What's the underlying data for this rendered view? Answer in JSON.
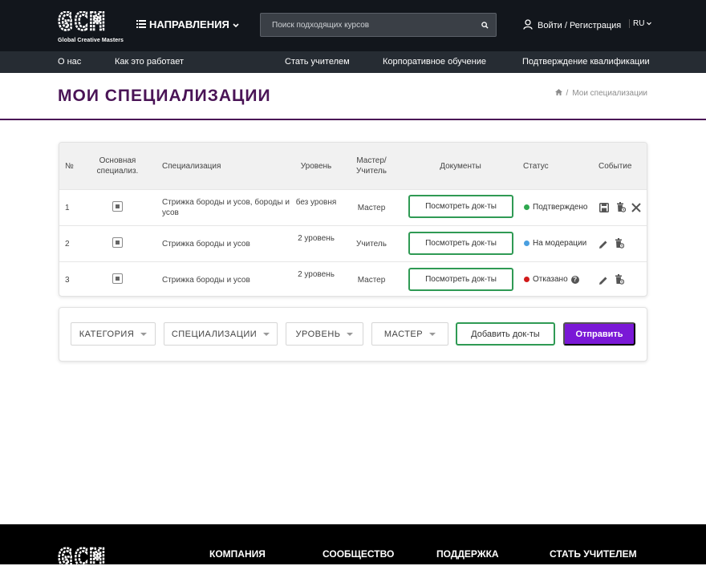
{
  "header": {
    "logo_letters": "GCM",
    "logo_sub": "Global Creative Masters",
    "directions_label": "НАПРАВЛЕНИЯ",
    "search_placeholder": "Поиск подходящих курсов",
    "login_label": "Войти / Регистрация",
    "lang": "RU"
  },
  "subnav": {
    "items": [
      "О нас",
      "Как это работает",
      "Стать учителем",
      "Корпоративное обучение",
      "Подтверждение квалификации"
    ]
  },
  "page": {
    "title": "МОИ СПЕЦИАЛИЗАЦИИ",
    "breadcrumb": "Мои специализации"
  },
  "table": {
    "headers": {
      "num": "№",
      "main": "Основная специализ.",
      "spec": "Специализация",
      "level": "Уровень",
      "role": "Мастер/ Учитель",
      "docs": "Документы",
      "status": "Статус",
      "event": "Событие"
    },
    "rows": [
      {
        "num": "1",
        "spec": "Стрижка бороды и усов, бороды и усов",
        "level": "без уровня",
        "role": "Мастер",
        "docs": "Посмотреть док-ты",
        "status": "Подтверждено",
        "status_color": "#2fa84f"
      },
      {
        "num": "2",
        "spec": "Стрижка бороды и усов",
        "level": "2 уровень",
        "role": "Учитель",
        "docs": "Посмотреть док-ты",
        "status": "На модерации",
        "status_color": "#4a9fe0"
      },
      {
        "num": "3",
        "spec": "Стрижка бороды и усов",
        "level": "2 уровень",
        "role": "Мастер",
        "docs": "Посмотреть док-ты",
        "status": "Отказано",
        "status_color": "#d11a1a"
      }
    ]
  },
  "filters": {
    "category": "КАТЕГОРИЯ",
    "specializations": "СПЕЦИАЛИЗАЦИИ",
    "level": "УРОВЕНЬ",
    "master": "МАСТЕР",
    "add_docs": "Добавить док-ты",
    "send": "Отправить"
  },
  "footer": {
    "logo_letters": "GCM",
    "columns": [
      "КОМПАНИЯ",
      "СООБЩЕСТВО",
      "ПОДДЕРЖКА",
      "СТАТЬ УЧИТЕЛЕМ"
    ]
  },
  "colors": {
    "brand_purple": "#4a1456",
    "accent_violet": "#7a18d6",
    "button_green": "#2f9a54",
    "header_dark": "#12161c"
  }
}
